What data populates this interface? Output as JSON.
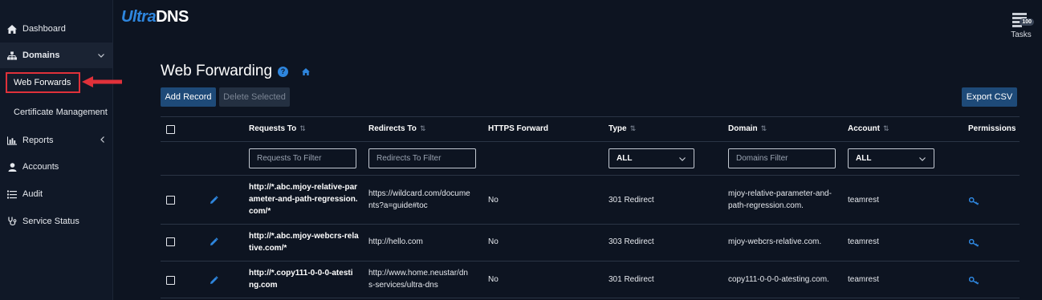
{
  "sidebar": {
    "items": [
      {
        "label": "Dashboard",
        "icon": "home-icon"
      },
      {
        "label": "Domains",
        "icon": "sitemap-icon"
      },
      {
        "label": "Reports",
        "icon": "bar-chart-icon"
      },
      {
        "label": "Accounts",
        "icon": "user-icon"
      },
      {
        "label": "Audit",
        "icon": "list-icon"
      },
      {
        "label": "Service Status",
        "icon": "stethoscope-icon"
      }
    ],
    "sub_items": [
      {
        "label": "Web Forwards"
      },
      {
        "label": "Certificate Management"
      }
    ]
  },
  "logo": {
    "ultra": "Ultra",
    "dns": "DNS"
  },
  "tasks": {
    "label": "Tasks",
    "badge": "100"
  },
  "page": {
    "title": "Web Forwarding"
  },
  "toolbar": {
    "add_label": "Add Record",
    "delete_label": "Delete Selected",
    "export_label": "Export CSV"
  },
  "table": {
    "headers": {
      "requests": "Requests To",
      "redirects": "Redirects To",
      "https": "HTTPS Forward",
      "type": "Type",
      "domain": "Domain",
      "account": "Account",
      "permissions": "Permissions"
    },
    "sort_glyph": "⇅",
    "filters": {
      "requests_placeholder": "Requests To Filter",
      "redirects_placeholder": "Redirects To Filter",
      "type_value": "ALL",
      "domains_placeholder": "Domains Filter",
      "account_value": "ALL"
    },
    "rows": [
      {
        "requests_lines": [
          "http://*.abc.mjoy-relative-par",
          "ameter-and-path-regression.",
          "com/*"
        ],
        "redirects_lines": [
          "https://wildcard.com/docume",
          "nts?a=guide#toc"
        ],
        "https": "No",
        "type": "301 Redirect",
        "domain_lines": [
          "mjoy-relative-parameter-and-",
          "path-regression.com."
        ],
        "account": "teamrest"
      },
      {
        "requests_lines": [
          "http://*.abc.mjoy-webcrs-rela",
          "tive.com/*"
        ],
        "redirects_lines": [
          "http://hello.com"
        ],
        "https": "No",
        "type": "303 Redirect",
        "domain_lines": [
          "mjoy-webcrs-relative.com."
        ],
        "account": "teamrest"
      },
      {
        "requests_lines": [
          "http://*.copy111-0-0-0-atesti",
          "ng.com"
        ],
        "redirects_lines": [
          "http://www.home.neustar/dn",
          "s-services/ultra-dns"
        ],
        "https": "No",
        "type": "301 Redirect",
        "domain_lines": [
          "copy111-0-0-0-atesting.com."
        ],
        "account": "teamrest"
      }
    ]
  },
  "colors": {
    "accent": "#2e86de",
    "background": "#0d1421",
    "highlight": "#e0313a"
  }
}
